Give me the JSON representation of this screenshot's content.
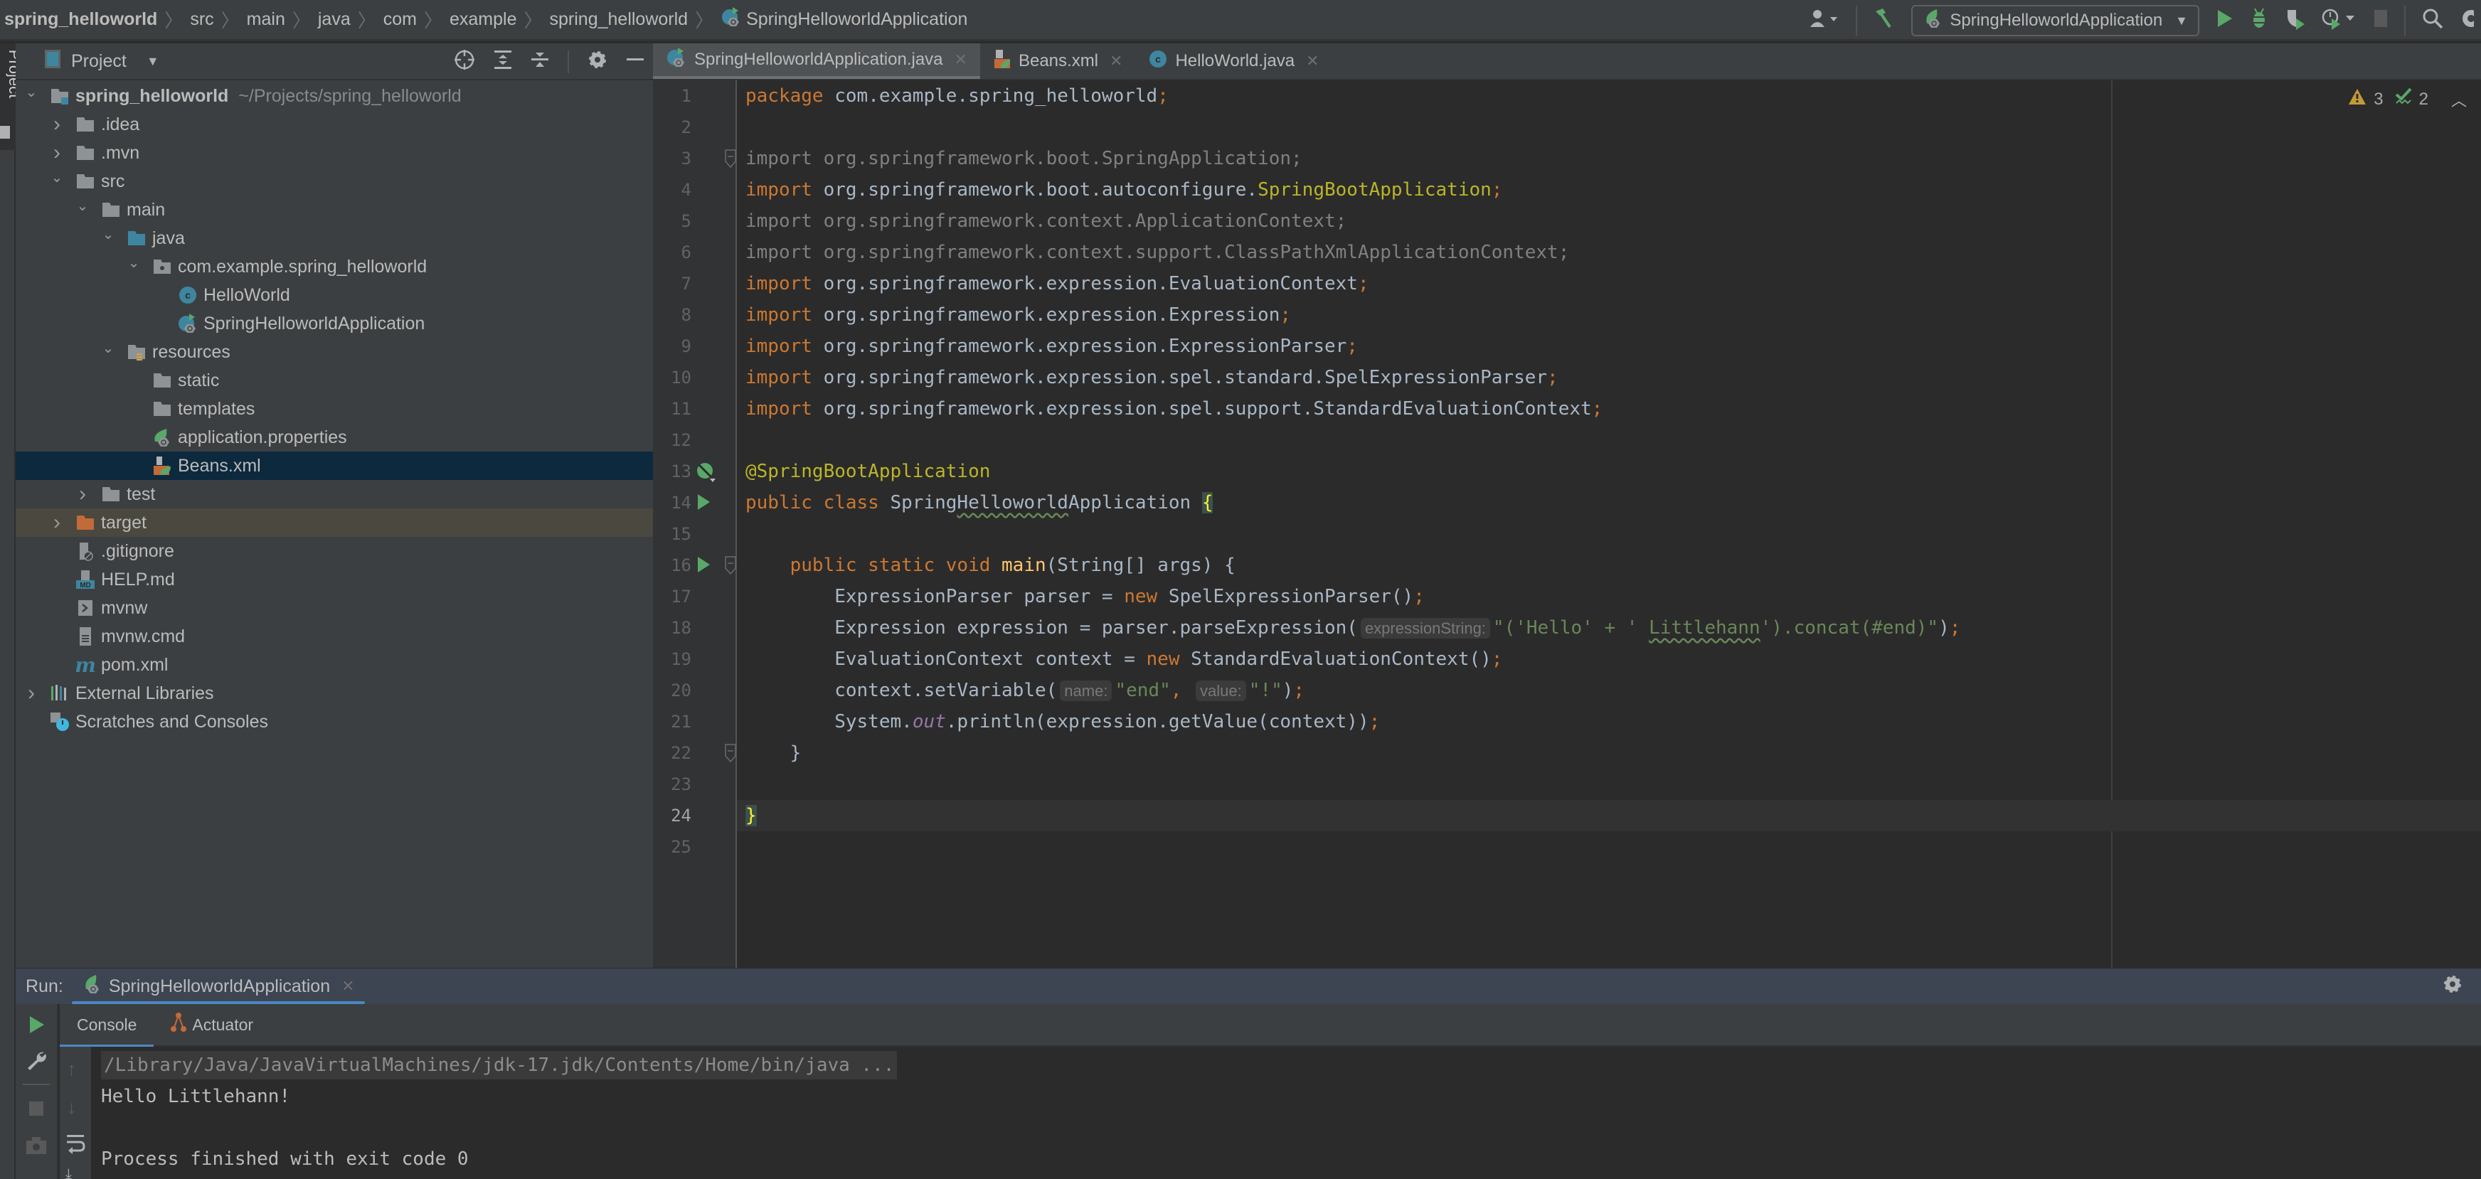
{
  "navbar": {
    "breadcrumbs": [
      "spring_helloworld",
      "src",
      "main",
      "java",
      "com",
      "example",
      "spring_helloworld",
      "SpringHelloworldApplication"
    ],
    "run_config": "SpringHelloworldApplication",
    "icons": [
      "user-icon",
      "build-hammer-icon",
      "run-icon",
      "debug-icon",
      "coverage-icon",
      "profile-icon",
      "stop-icon",
      "search-icon",
      "settings-icon"
    ]
  },
  "left_strip": {
    "project_label": "Project"
  },
  "project_panel": {
    "title": "Project",
    "tree": [
      {
        "label": "spring_helloworld",
        "suffix": "~/Projects/spring_helloworld",
        "level": 0,
        "expanded": true,
        "icon": "module-folder-icon"
      },
      {
        "label": ".idea",
        "level": 1,
        "expanded": false,
        "icon": "folder-icon"
      },
      {
        "label": ".mvn",
        "level": 1,
        "expanded": false,
        "icon": "folder-icon"
      },
      {
        "label": "src",
        "level": 1,
        "expanded": true,
        "icon": "folder-icon"
      },
      {
        "label": "main",
        "level": 2,
        "expanded": true,
        "icon": "folder-icon"
      },
      {
        "label": "java",
        "level": 3,
        "expanded": true,
        "icon": "source-folder-icon"
      },
      {
        "label": "com.example.spring_helloworld",
        "level": 4,
        "expanded": true,
        "icon": "package-icon"
      },
      {
        "label": "HelloWorld",
        "level": 5,
        "icon": "java-class-icon"
      },
      {
        "label": "SpringHelloworldApplication",
        "level": 5,
        "icon": "spring-boot-class-icon"
      },
      {
        "label": "resources",
        "level": 3,
        "expanded": true,
        "icon": "resources-folder-icon"
      },
      {
        "label": "static",
        "level": 4,
        "icon": "folder-icon"
      },
      {
        "label": "templates",
        "level": 4,
        "icon": "folder-icon"
      },
      {
        "label": "application.properties",
        "level": 4,
        "icon": "spring-properties-icon"
      },
      {
        "label": "Beans.xml",
        "level": 4,
        "icon": "spring-xml-icon",
        "selected": true
      },
      {
        "label": "test",
        "level": 2,
        "expanded": false,
        "icon": "folder-icon"
      },
      {
        "label": "target",
        "level": 1,
        "expanded": false,
        "icon": "excluded-folder-icon",
        "excluded": true
      },
      {
        "label": ".gitignore",
        "level": 1,
        "icon": "gitignore-file-icon"
      },
      {
        "label": "HELP.md",
        "level": 1,
        "icon": "markdown-file-icon"
      },
      {
        "label": "mvnw",
        "level": 1,
        "icon": "shell-script-icon"
      },
      {
        "label": "mvnw.cmd",
        "level": 1,
        "icon": "text-file-icon"
      },
      {
        "label": "pom.xml",
        "level": 1,
        "icon": "maven-icon"
      },
      {
        "label": "External Libraries",
        "level": 0,
        "expanded": false,
        "icon": "libraries-icon"
      },
      {
        "label": "Scratches and Consoles",
        "level": 0,
        "icon": "scratches-icon"
      }
    ]
  },
  "editor": {
    "tabs": [
      {
        "label": "SpringHelloworldApplication.java",
        "active": true,
        "icon": "spring-boot-class-icon"
      },
      {
        "label": "Beans.xml",
        "active": false,
        "icon": "spring-xml-icon"
      },
      {
        "label": "HelloWorld.java",
        "active": false,
        "icon": "java-class-icon"
      }
    ],
    "inspections": {
      "warnings": "3",
      "weak_warnings": "2"
    },
    "current_line": 24,
    "line_numbers": [
      "1",
      "2",
      "3",
      "4",
      "5",
      "6",
      "7",
      "8",
      "9",
      "10",
      "11",
      "12",
      "13",
      "14",
      "15",
      "16",
      "17",
      "18",
      "19",
      "20",
      "21",
      "22",
      "23",
      "24",
      "25"
    ],
    "code": {
      "l1": {
        "kw": "package",
        "rest": " com.example.spring_helloworld",
        "semi": ";"
      },
      "l3": "import org.springframework.boot.SpringApplication;",
      "l4": {
        "kw": "import",
        "pkg": " org.springframework.boot.autoconfigure.",
        "cls": "SpringBootApplication",
        "semi": ";"
      },
      "l5": "import org.springframework.context.ApplicationContext;",
      "l6": "import org.springframework.context.support.ClassPathXmlApplicationContext;",
      "l7": {
        "kw": "import",
        "rest": " org.springframework.expression.EvaluationContext",
        "semi": ";"
      },
      "l8": {
        "kw": "import",
        "rest": " org.springframework.expression.Expression",
        "semi": ";"
      },
      "l9": {
        "kw": "import",
        "rest": " org.springframework.expression.ExpressionParser",
        "semi": ";"
      },
      "l10": {
        "kw": "import",
        "rest": " org.springframework.expression.spel.standard.SpelExpressionParser",
        "semi": ";"
      },
      "l11": {
        "kw": "import",
        "rest": " org.springframework.expression.spel.support.StandardEvaluationContext",
        "semi": ";"
      },
      "l13": "@SpringBootApplication",
      "l14": {
        "kw": "public class ",
        "name_a": "Spring",
        "name_b": "Helloworld",
        "name_c": "Application ",
        "brace": "{"
      },
      "l16": {
        "kw": "    public static void ",
        "fn": "main",
        "rest": "(String[] args) {"
      },
      "l17": {
        "a": "        ExpressionParser parser = ",
        "kw": "new",
        "b": " SpelExpressionParser()",
        "semi": ";"
      },
      "l18": {
        "a": "        Expression expression = parser.parseExpression(",
        "hint": "expressionString:",
        "s1": "\"('Hello' + ' ",
        "s2": "Littlehann",
        "s3": "').concat(#end)\"",
        "b": ")",
        "semi": ";"
      },
      "l19": {
        "a": "        EvaluationContext context = ",
        "kw": "new",
        "b": " StandardEvaluationContext()",
        "semi": ";"
      },
      "l20": {
        "a": "        context.setVariable(",
        "hint1": "name:",
        "s1": "\"end\"",
        "comma": ",",
        "hint2": "value:",
        "s2": "\"!\"",
        "b": ")",
        "semi": ";"
      },
      "l21": {
        "a": "        System.",
        "out": "out",
        "b": ".println(expression.getValue(context))",
        "semi": ";"
      },
      "l22": "    }",
      "l24": "}"
    }
  },
  "run_panel": {
    "label": "Run:",
    "tab": "SpringHelloworldApplication",
    "subtabs": [
      "Console",
      "Actuator"
    ],
    "console": [
      "/Library/Java/JavaVirtualMachines/jdk-17.jdk/Contents/Home/bin/java ...",
      "Hello Littlehann!",
      "",
      "Process finished with exit code 0"
    ]
  },
  "colors": {
    "keyword": "#cc7832",
    "string": "#6a8759",
    "annotation": "#bbb529",
    "selection": "#0d293e",
    "accent": "#4a88c7",
    "run_green": "#59a869"
  }
}
